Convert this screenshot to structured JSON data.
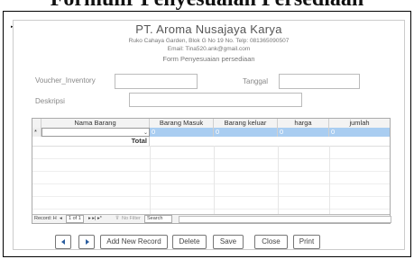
{
  "page_heading": "Formulir Penyesuaian Persediaan",
  "form": {
    "company": "PT. Aroma Nusajaya Karya",
    "address": "Ruko Cahaya Garden, Blok G No 19 No. Telp: 081365090507",
    "email": "Email: Tina520.ank@gmail.com",
    "form_title": "Form Penyesuaian persediaan",
    "voucher_label": "Voucher_Inventory",
    "tanggal_label": "Tanggal",
    "deskripsi_label": "Deskripsi",
    "voucher_value": "",
    "tanggal_value": "",
    "deskripsi_value": ""
  },
  "grid": {
    "headers": [
      "Nama Barang",
      "Barang Masuk",
      "Barang keluar",
      "harga",
      "jumlah"
    ],
    "new_row": [
      "",
      "0",
      "0",
      "0",
      "0"
    ],
    "new_row_marker": "*",
    "total_label": "Total"
  },
  "navigator": {
    "record_label": "Record: H",
    "position": "1 of 1",
    "filter": "No Filter",
    "search": "Search"
  },
  "buttons": {
    "add_new": "Add New Record",
    "delete": "Delete",
    "save": "Save",
    "close": "Close",
    "print": "Print"
  },
  "colors": {
    "selected_row": "#a9cdf1",
    "nav_arrow": "#2a5d9f"
  }
}
